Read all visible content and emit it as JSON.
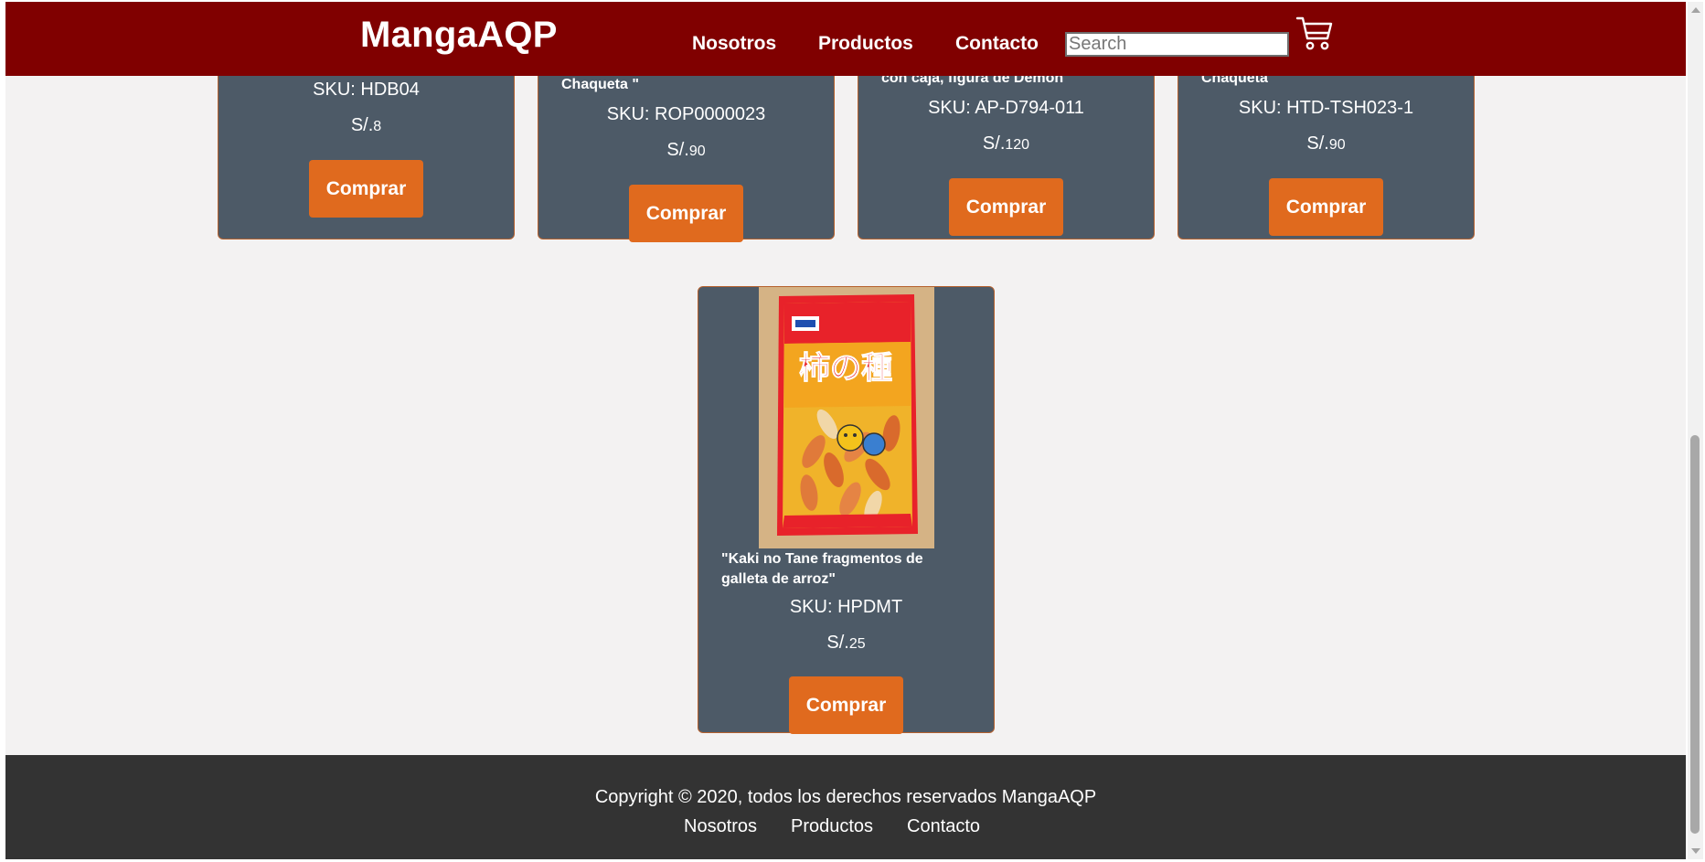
{
  "header": {
    "brand": "MangaAQP",
    "nav": [
      "Nosotros",
      "Productos",
      "Contacto"
    ],
    "search_placeholder": "Search",
    "cart_icon": "cart-icon"
  },
  "products": [
    {
      "title": "",
      "sku": "SKU: HDB04",
      "currency": "S/.",
      "price": "8",
      "button": "Comprar"
    },
    {
      "title": "Chaqueta \"",
      "sku": "SKU: ROP0000023",
      "currency": "S/.",
      "price": "90",
      "button": "Comprar"
    },
    {
      "title": "con caja, figura de Demon\"",
      "sku": "SKU: AP-D794-011",
      "currency": "S/.",
      "price": "120",
      "button": "Comprar"
    },
    {
      "title": "Chaqueta",
      "sku": "SKU: HTD-TSH023-1",
      "currency": "S/.",
      "price": "90",
      "button": "Comprar"
    },
    {
      "title": "\"Kaki no Tane fragmentos de galleta de arroz\"",
      "sku": "SKU: HPDMT",
      "currency": "S/.",
      "price": "25",
      "button": "Comprar",
      "image": "rice-cracker-package-image"
    }
  ],
  "footer": {
    "copyright": "Copyright © 2020, todos los derechos reservados MangaAQP",
    "links": [
      "Nosotros",
      "Productos",
      "Contacto"
    ]
  }
}
